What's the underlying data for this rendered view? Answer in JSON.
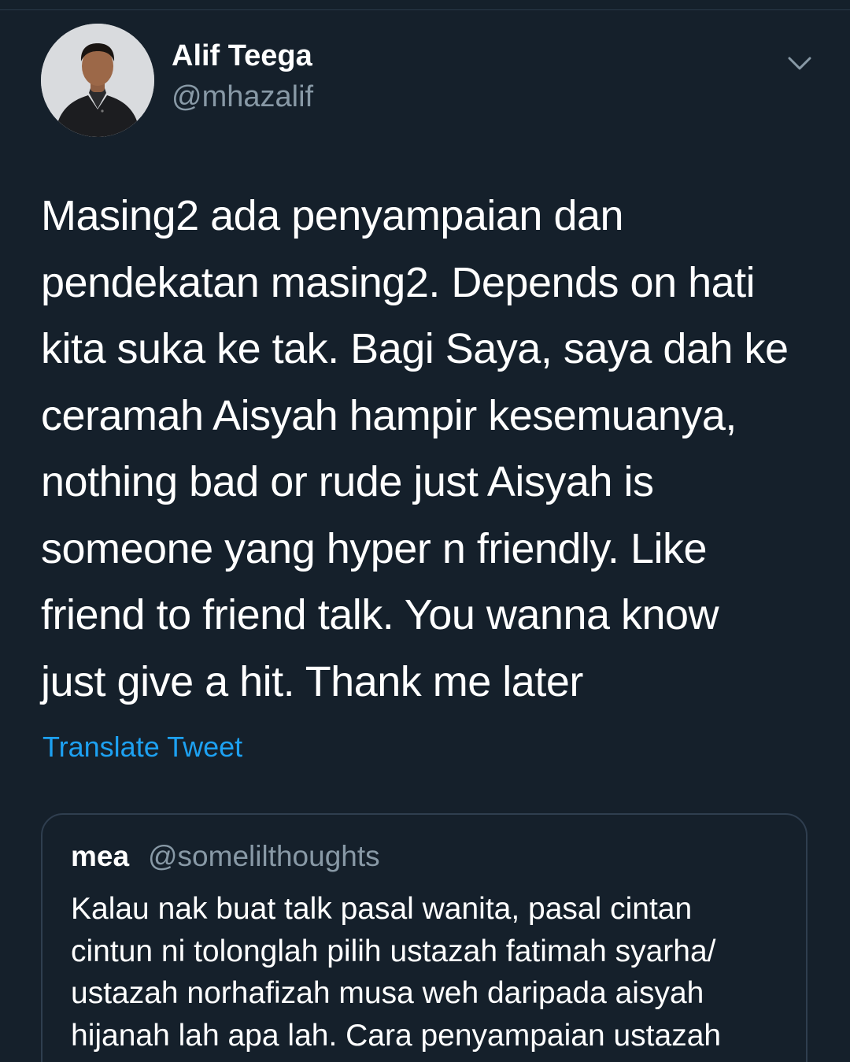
{
  "tweet": {
    "author": {
      "name": "Alif Teega",
      "handle": "@mhazalif"
    },
    "text": "Masing2 ada penyampaian dan\npendekatan masing2. Depends on hati\nkita suka ke tak. Bagi Saya, saya dah ke\nceramah Aisyah hampir kesemuanya,\nnothing bad or rude just Aisyah is\nsomeone yang hyper n friendly. Like\nfriend to friend talk. You wanna know\njust give a hit. Thank me later",
    "translate_label": "Translate Tweet",
    "menu_icon": "chevron-down-icon"
  },
  "quoted_tweet": {
    "author_name": "mea",
    "author_handle": "@somelilthoughts",
    "text": "Kalau nak buat talk pasal wanita, pasal cintan\ncintun ni tolonglah pilih ustazah fatimah syarha/\nustazah norhafizah musa weh daripada aisyah\nhijanah lah apa lah. Cara penyampaian ustazah"
  },
  "colors": {
    "background": "#15202b",
    "primary_text": "#ffffff",
    "secondary_text": "#8899a6",
    "link": "#1da1f2",
    "border": "#2f3e4f"
  }
}
